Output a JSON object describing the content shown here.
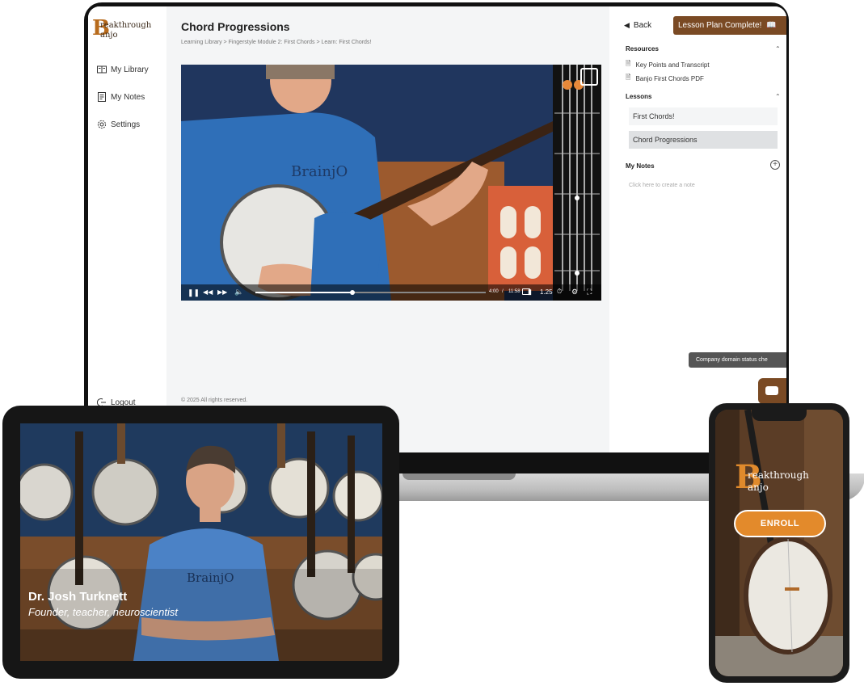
{
  "brand": {
    "logo_line1": "reakthrough",
    "logo_line2": "anjo",
    "logo_initial": "B",
    "accent": "#b86b1c",
    "button_brown": "#7a4a24",
    "enroll_orange": "#e38a2b"
  },
  "sidebar": {
    "items": [
      {
        "label": "My Library",
        "icon": "book-icon"
      },
      {
        "label": "My Notes",
        "icon": "notes-icon"
      },
      {
        "label": "Settings",
        "icon": "gear-icon"
      }
    ],
    "logout": "Logout"
  },
  "main": {
    "title": "Chord Progressions",
    "breadcrumb": "Learning Library > Fingerstyle Module 2: First Chords > Learn: First Chords!",
    "copyright": "© 2025 All rights reserved."
  },
  "video": {
    "time_current": "4:00",
    "time_separator": "/",
    "time_total": "11:58",
    "speed": "1.25",
    "progress": 0.42,
    "shirt_text": "BrainjO"
  },
  "right_panel": {
    "back": "Back",
    "complete_button": "Lesson Plan Complete!",
    "resources_heading": "Resources",
    "resources": [
      "Key Points and Transcript",
      "Banjo First Chords PDF"
    ],
    "lessons_heading": "Lessons",
    "lessons": [
      "First Chords!",
      "Chord Progressions"
    ],
    "notes_heading": "My Notes",
    "notes_placeholder": "Click here to create a note",
    "tooltip": "Company domain status che"
  },
  "tablet": {
    "name": "Dr. Josh Turknett",
    "role": "Founder, teacher, neuroscientist"
  },
  "phone": {
    "enroll": "ENROLL"
  }
}
